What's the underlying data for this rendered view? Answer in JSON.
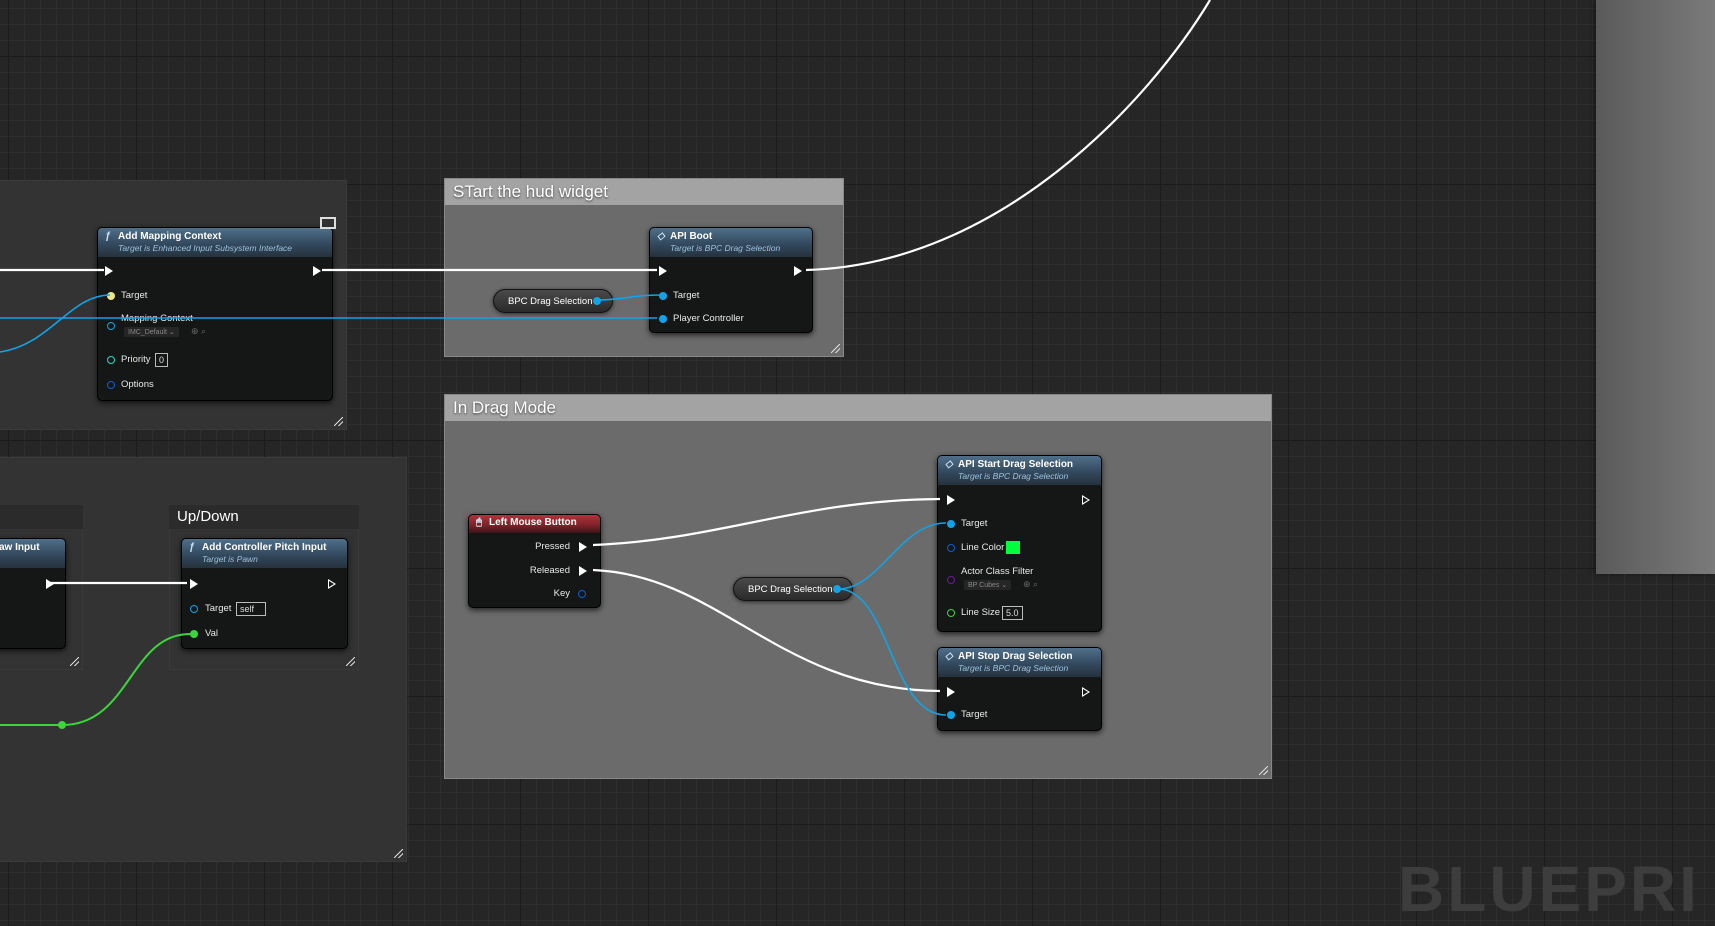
{
  "comments": {
    "start_hud": "STart the hud widget",
    "drag_mode": "In Drag Mode",
    "up_down": "Up/Down"
  },
  "nodes": {
    "add_mapping": {
      "title": "Add Mapping Context",
      "subtitle": "Target is Enhanced Input Subsystem Interface",
      "pins": {
        "target": "Target",
        "mapping_context": "Mapping Context",
        "priority": "Priority",
        "options": "Options"
      },
      "mapping_value": "IMC_Default",
      "priority_value": "0"
    },
    "api_boot": {
      "title": "API Boot",
      "subtitle": "Target is BPC Drag Selection",
      "pins": {
        "target": "Target",
        "player_controller": "Player Controller"
      }
    },
    "left_mouse": {
      "title": "Left Mouse Button",
      "pins": {
        "pressed": "Pressed",
        "released": "Released",
        "key": "Key"
      }
    },
    "start_drag": {
      "title": "API Start Drag Selection",
      "subtitle": "Target is BPC Drag Selection",
      "pins": {
        "target": "Target",
        "line_color": "Line Color",
        "actor_class_filter": "Actor Class Filter",
        "line_size": "Line Size"
      },
      "actor_class_value": "BP Cubes",
      "line_size_value": "5.0",
      "line_color_value": "#00ff3a"
    },
    "stop_drag": {
      "title": "API Stop Drag Selection",
      "subtitle": "Target is BPC Drag Selection",
      "pins": {
        "target": "Target"
      }
    },
    "pitch": {
      "title": "Add Controller Pitch Input",
      "subtitle": "Target is Pawn",
      "pins": {
        "target": "Target",
        "val": "Val"
      },
      "target_value": "self"
    },
    "yaw_partial": {
      "title": "aw Input"
    },
    "var_bpc_1": "BPC Drag Selection",
    "var_bpc_2": "BPC Drag Selection"
  },
  "watermark": "BLUEPRI",
  "colors": {
    "exec": "#ffffff",
    "object": "#0fa4e8",
    "float": "#3bd63b",
    "struct": "#0a5fd8",
    "int": "#1fe0c0"
  }
}
